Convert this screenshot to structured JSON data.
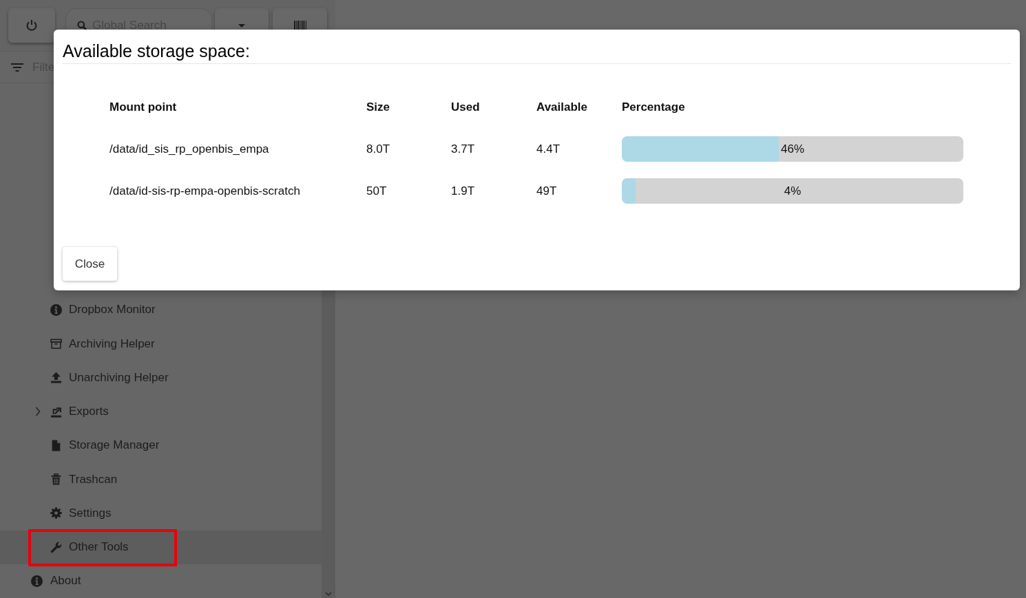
{
  "toolbar": {
    "search_placeholder": "Global Search"
  },
  "filter": {
    "placeholder": "Filte"
  },
  "sidebar": {
    "items": [
      {
        "children": [
          {
            "label": "Dropbox Monitor",
            "selected": false,
            "highlighted": false
          },
          {
            "label": "Archiving Helper",
            "selected": false,
            "highlighted": false
          },
          {
            "label": "Unarchiving Helper",
            "selected": false,
            "highlighted": false
          },
          {
            "label": "Exports",
            "selected": false,
            "highlighted": false,
            "expanded": false
          },
          {
            "label": "Storage Manager",
            "selected": false,
            "highlighted": false
          },
          {
            "label": "Trashcan",
            "selected": false,
            "highlighted": false
          },
          {
            "label": "Settings",
            "selected": false,
            "highlighted": false
          },
          {
            "label": "Other Tools",
            "selected": true,
            "highlighted": true
          }
        ]
      },
      {
        "label": "About",
        "selected": false,
        "highlighted": false
      }
    ]
  },
  "dialog": {
    "title": "Available storage space:",
    "columns": [
      "Mount point",
      "Size",
      "Used",
      "Available",
      "Percentage"
    ],
    "rows": [
      {
        "mount_point": "/data/id_sis_rp_openbis_empa",
        "size": "8.0T",
        "used": "3.7T",
        "available": "4.4T",
        "level": 0.46,
        "percentage": "46%"
      },
      {
        "mount_point": "/data/id-sis-rp-empa-openbis-scratch",
        "size": "50T",
        "used": "1.9T",
        "available": "49T",
        "level": 0.04,
        "percentage": "4%"
      }
    ],
    "close_button": "Close"
  }
}
